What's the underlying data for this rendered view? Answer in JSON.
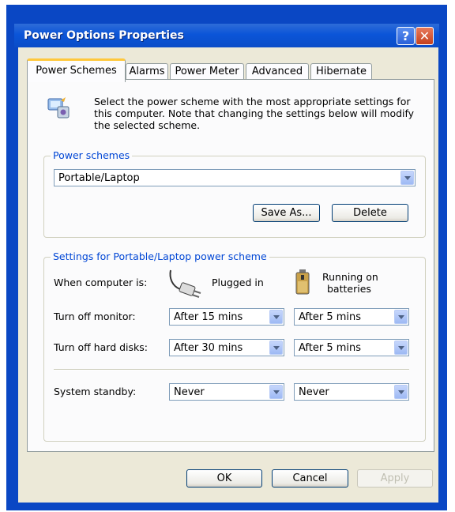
{
  "window": {
    "title": "Power Options Properties",
    "help_glyph": "?",
    "close_glyph": "✕"
  },
  "tabs": [
    "Power Schemes",
    "Alarms",
    "Power Meter",
    "Advanced",
    "Hibernate"
  ],
  "intro": {
    "text": "Select the power scheme with the most appropriate settings for this computer. Note that changing the settings below will modify the selected scheme."
  },
  "schemes_group": {
    "label": "Power schemes",
    "selected": "Portable/Laptop",
    "save_as": "Save As...",
    "delete": "Delete"
  },
  "settings_group": {
    "label": "Settings for Portable/Laptop power scheme",
    "when_label": "When computer is:",
    "plugged_label": "Plugged in",
    "battery_label_1": "Running on",
    "battery_label_2": "batteries",
    "rows": [
      {
        "label": "Turn off monitor:",
        "plugged": "After 15 mins",
        "battery": "After 5 mins"
      },
      {
        "label": "Turn off hard disks:",
        "plugged": "After 30 mins",
        "battery": "After 5 mins"
      },
      {
        "label": "System standby:",
        "plugged": "Never",
        "battery": "Never"
      }
    ]
  },
  "footer": {
    "ok": "OK",
    "cancel": "Cancel",
    "apply": "Apply"
  },
  "icons": [
    "power-scheme-icon",
    "help-icon",
    "close-icon",
    "plug-icon",
    "battery-icon",
    "chevron-down-icon"
  ]
}
